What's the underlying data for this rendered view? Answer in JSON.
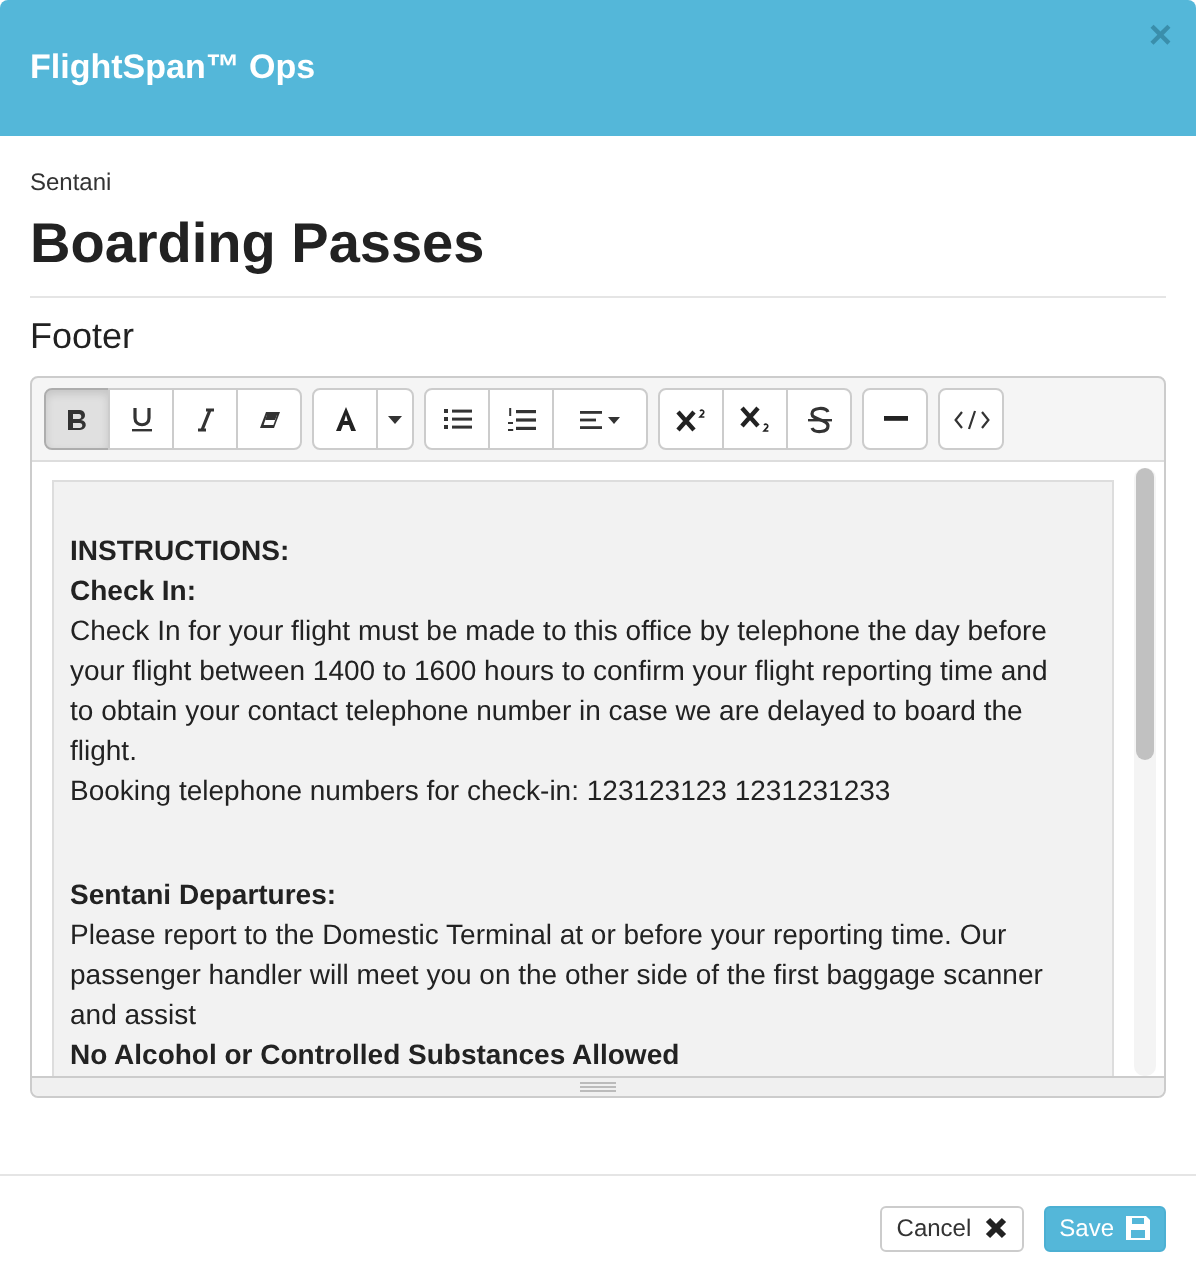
{
  "window": {
    "title": "FlightSpan™ Ops",
    "close": "×"
  },
  "subtitle": "Sentani",
  "heading": "Boarding Passes",
  "section_label": "Footer",
  "toolbar": [
    [
      {
        "kind": "bold",
        "selected": true
      },
      {
        "kind": "underline",
        "selected": false
      },
      {
        "kind": "italic",
        "selected": false
      },
      {
        "kind": "eraser",
        "selected": false
      }
    ],
    [
      {
        "kind": "font-color",
        "selected": false
      },
      {
        "kind": "caret",
        "selected": false
      }
    ],
    [
      {
        "kind": "bullet-list",
        "selected": false
      },
      {
        "kind": "numbered-list",
        "selected": false
      },
      {
        "kind": "align",
        "selected": false
      }
    ],
    [
      {
        "kind": "superscript",
        "selected": false
      },
      {
        "kind": "subscript",
        "selected": false
      },
      {
        "kind": "strikethrough",
        "selected": false
      }
    ],
    [
      {
        "kind": "rule",
        "selected": false
      }
    ],
    [
      {
        "kind": "code",
        "selected": false
      }
    ]
  ],
  "content": [
    {
      "kind": "heading",
      "text": "INSTRUCTIONS:"
    },
    {
      "kind": "heading",
      "text": "Check In:"
    },
    {
      "kind": "text",
      "text": "Check In for your flight must be made to this office by telephone the day before your flight between 1400 to 1600 hours to confirm your flight reporting time and to obtain your contact telephone number in case we are delayed to board the flight."
    },
    {
      "kind": "text",
      "text": "Booking telephone numbers for check-in: 123123123 1231231233"
    },
    {
      "kind": "gap"
    },
    {
      "kind": "heading",
      "text": "Sentani Departures:"
    },
    {
      "kind": "text",
      "text": "Please report to the Domestic Terminal at or before your reporting time. Our passenger handler will meet you on the other side of the first baggage scanner and assist"
    },
    {
      "kind": "heading",
      "text": "No Alcohol or Controlled Substances Allowed"
    }
  ],
  "buttons": [
    {
      "kind": "cancel",
      "label": "Cancel"
    },
    {
      "kind": "save",
      "label": "Save"
    }
  ]
}
